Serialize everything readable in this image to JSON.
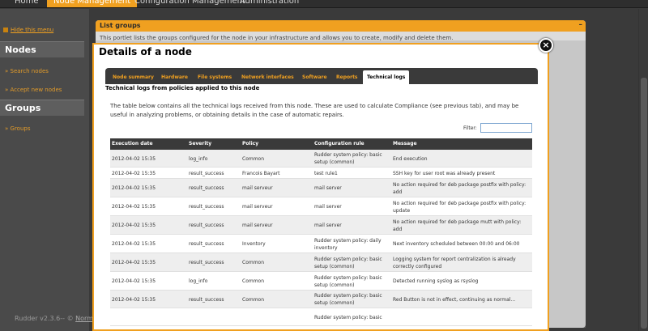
{
  "top_menu": {
    "items": [
      {
        "label": "Home"
      },
      {
        "label": "Node Management"
      },
      {
        "label": "Configuration Management"
      },
      {
        "label": "Administration"
      }
    ]
  },
  "sidebar": {
    "hide_menu": "Hide this menu",
    "sections": [
      {
        "title": "Nodes",
        "links": [
          "Search nodes",
          "Accept new nodes"
        ]
      },
      {
        "title": "Groups",
        "links": [
          "Groups"
        ]
      }
    ]
  },
  "footer": {
    "version": "Rudder v2.3.6-- ©",
    "link": "Normation"
  },
  "portlet": {
    "title": "List groups",
    "collapse": "–",
    "description": "This portlet lists the groups configured for the node in your infrastructure and allows you to create, modify and delete them."
  },
  "modal": {
    "title": "Details of a node",
    "close": "×",
    "tabs": [
      "Node summary",
      "Hardware",
      "File systems",
      "Network interfaces",
      "Software",
      "Reports",
      "Technical logs"
    ],
    "active_tab": "Technical logs",
    "section_title": "Technical logs from policies applied to this node",
    "intro": "The table below contains all the technical logs received from this node. These are used to calculate Compliance (see previous tab), and may be useful in analyzing problems, or obtaining details in the case of automatic repairs.",
    "filter_label": "Filter:",
    "filter_value": "",
    "columns": [
      "Execution date",
      "Severity",
      "Policy",
      "Configuration rule",
      "Message"
    ],
    "rows": [
      {
        "date": "2012-04-02 15:35",
        "severity": "log_info",
        "policy": "Common",
        "rule": "Rudder system policy: basic setup (common)",
        "message": "End execution"
      },
      {
        "date": "2012-04-02 15:35",
        "severity": "result_success",
        "policy": "Francois Bayart",
        "rule": "test rule1",
        "message": "SSH key for user root was already present"
      },
      {
        "date": "2012-04-02 15:35",
        "severity": "result_success",
        "policy": "mail serveur",
        "rule": "mail server",
        "message": "No action required for deb package postfix with policy: add"
      },
      {
        "date": "2012-04-02 15:35",
        "severity": "result_success",
        "policy": "mail serveur",
        "rule": "mail server",
        "message": "No action required for deb package postfix with policy: update"
      },
      {
        "date": "2012-04-02 15:35",
        "severity": "result_success",
        "policy": "mail serveur",
        "rule": "mail server",
        "message": "No action required for deb package mutt with policy: add"
      },
      {
        "date": "2012-04-02 15:35",
        "severity": "result_success",
        "policy": "Inventory",
        "rule": "Rudder system policy: daily inventory",
        "message": "Next inventory scheduled between 00:00 and 06:00"
      },
      {
        "date": "2012-04-02 15:35",
        "severity": "result_success",
        "policy": "Common",
        "rule": "Rudder system policy: basic setup (common)",
        "message": "Logging system for report centralization is already correctly configured"
      },
      {
        "date": "2012-04-02 15:35",
        "severity": "log_info",
        "policy": "Common",
        "rule": "Rudder system policy: basic setup (common)",
        "message": "Detected running syslog as rsyslog"
      },
      {
        "date": "2012-04-02 15:35",
        "severity": "result_success",
        "policy": "Common",
        "rule": "Rudder system policy: basic setup (common)",
        "message": "Red Button is not in effect, continuing as normal..."
      },
      {
        "date": "",
        "severity": "",
        "policy": "",
        "rule": "Rudder system policy: basic",
        "message": ""
      }
    ]
  }
}
